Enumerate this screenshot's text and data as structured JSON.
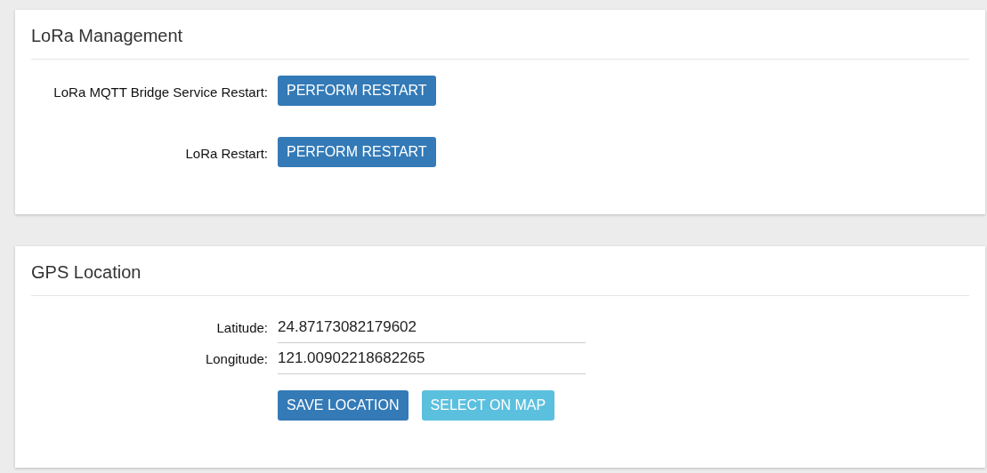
{
  "panels": [
    {
      "title": "LoRa Management",
      "rows": [
        {
          "kind": "action",
          "label": "LoRa MQTT Bridge Service Restart:",
          "button": "PERFORM RESTART"
        },
        {
          "kind": "action",
          "label": "LoRa Restart:",
          "button": "PERFORM RESTART"
        }
      ]
    },
    {
      "title": "GPS Location",
      "rows": [
        {
          "kind": "field",
          "label": "Latitude:",
          "value": "24.87173082179602"
        },
        {
          "kind": "field",
          "label": "Longitude:",
          "value": "121.00902218682265"
        },
        {
          "kind": "buttons",
          "buttons": [
            {
              "label": "SAVE LOCATION",
              "kind": "primary"
            },
            {
              "label": "SELECT ON MAP",
              "kind": "info"
            }
          ]
        }
      ]
    }
  ]
}
